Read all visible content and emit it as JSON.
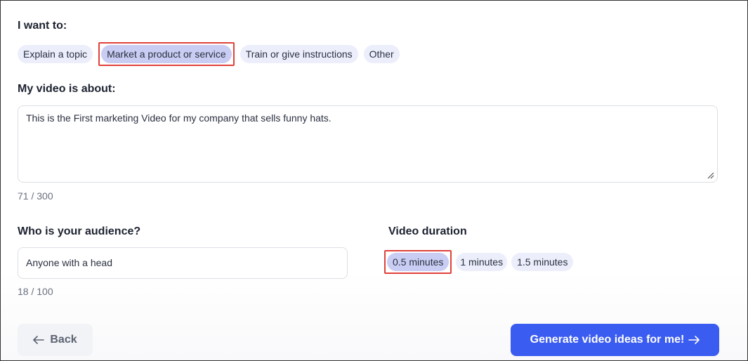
{
  "purpose": {
    "label": "I want to:",
    "options": [
      "Explain a topic",
      "Market a product or service",
      "Train or give instructions",
      "Other"
    ],
    "selected": "Market a product or service"
  },
  "about": {
    "label": "My video is about:",
    "value": "This is the First marketing Video for my company that sells funny hats.",
    "counter": "71 / 300"
  },
  "audience": {
    "label": "Who is your audience?",
    "value": "Anyone with a head",
    "counter": "18 / 100"
  },
  "duration": {
    "label": "Video duration",
    "options": [
      "0.5 minutes",
      "1 minutes",
      "1.5 minutes"
    ],
    "selected": "0.5 minutes"
  },
  "actions": {
    "back_label": "Back",
    "generate_label": "Generate video ideas for me!"
  },
  "colors": {
    "primary": "#3b5cf0",
    "chip": "#eceefb",
    "chip_selected": "#c9cdf3",
    "highlight": "#e0413a"
  },
  "icons": {
    "back": "arrow-left-icon",
    "generate": "arrow-right-icon",
    "resize": "resize-handle-icon"
  }
}
